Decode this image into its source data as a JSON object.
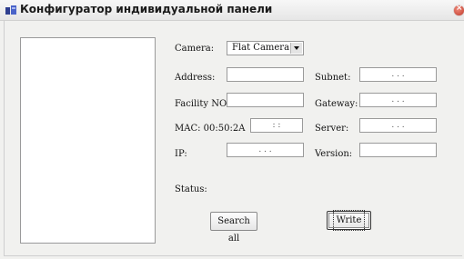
{
  "window": {
    "title": "Конфигуратор индивидуальной панели",
    "icon": "app-panel-icon",
    "close_icon": "close-icon"
  },
  "form": {
    "camera_label": "Camera:",
    "camera_value": "Flat Camera",
    "address_label": "Address:",
    "address_value": "",
    "subnet_label": "Subnet:",
    "subnet_value": ". . .",
    "facility_label": "Facility NO.:",
    "facility_value": "",
    "gateway_label": "Gateway:",
    "gateway_value": ". . .",
    "mac_label": "MAC: 00:50:2A",
    "mac_value": ": :",
    "server_label": "Server:",
    "server_value": ". . .",
    "ip_label": "IP:",
    "ip_value": ". . .",
    "version_label": "Version:",
    "version_value": "",
    "status_label": "Status:"
  },
  "buttons": {
    "search_all": "Search all",
    "write": "Write"
  },
  "colors": {
    "window_bg": "#f1f1ef",
    "close_button": "#c0392b"
  }
}
